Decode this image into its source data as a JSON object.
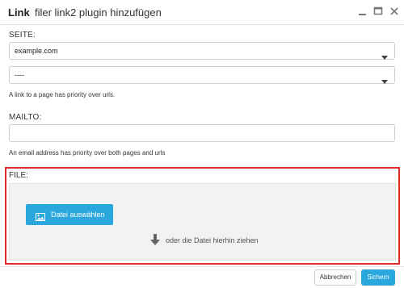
{
  "window": {
    "title": "Link",
    "subtitle": "filer link2 plugin hinzufügen"
  },
  "form": {
    "page_label": "SEITE:",
    "page_select_value": "example.com",
    "anchor_select_value": "----",
    "page_help": "A link to a page has priority over urls.",
    "mailto_label": "MAILTO:",
    "mailto_value": "",
    "mailto_help": "An email address has priority over both pages and urls",
    "file_label": "FILE:",
    "choose_file_label": "Datei auswählen",
    "drop_hint": "oder die Datei hierhin ziehen"
  },
  "footer": {
    "cancel_label": "Abbrechen",
    "save_label": "Sichern"
  },
  "colors": {
    "accent": "#2aa7dd",
    "highlight": "#e02a2a"
  }
}
